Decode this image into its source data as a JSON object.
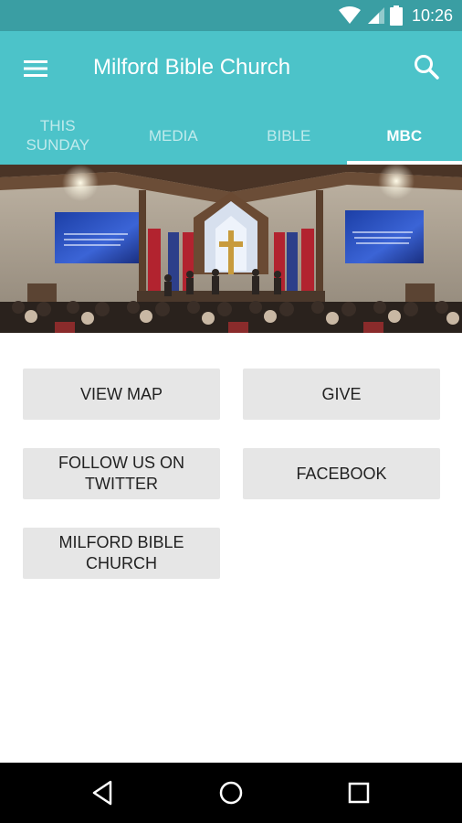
{
  "status_bar": {
    "time": "10:26"
  },
  "toolbar": {
    "title": "Milford Bible Church"
  },
  "tabs": [
    {
      "label": "THIS\nSUNDAY",
      "active": false
    },
    {
      "label": "MEDIA",
      "active": false
    },
    {
      "label": "BIBLE",
      "active": false
    },
    {
      "label": "MBC",
      "active": true
    }
  ],
  "actions": {
    "view_map": "VIEW MAP",
    "give": "GIVE",
    "twitter": "FOLLOW US ON\nTWITTER",
    "facebook": "FACEBOOK",
    "church": "MILFORD BIBLE\nCHURCH"
  },
  "colors": {
    "status_bar": "#3a9ea3",
    "toolbar": "#4cc3c9",
    "button": "#e6e6e6"
  },
  "icons": [
    "wifi-icon",
    "signal-icon",
    "battery-icon",
    "menu-icon",
    "search-icon",
    "back-icon",
    "home-icon",
    "recents-icon"
  ]
}
